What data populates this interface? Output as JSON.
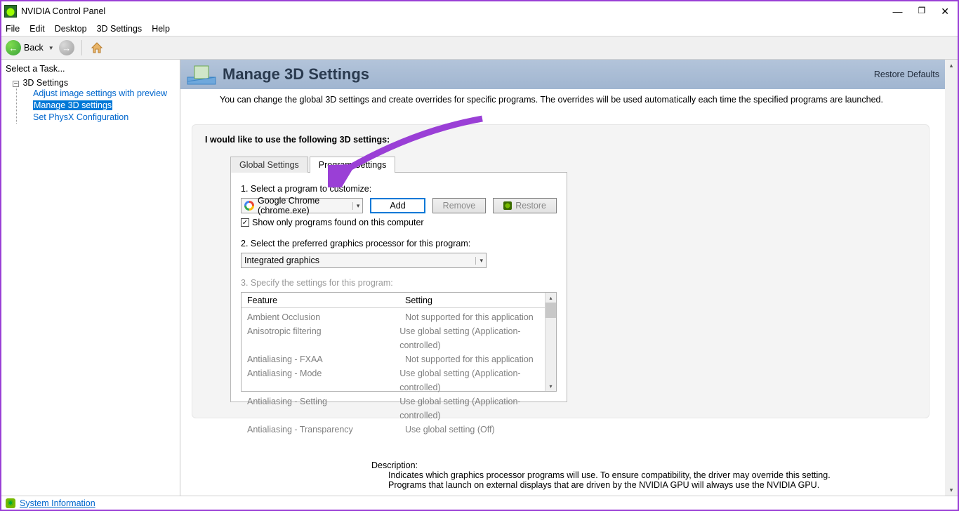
{
  "window": {
    "title": "NVIDIA Control Panel"
  },
  "menu": {
    "file": "File",
    "edit": "Edit",
    "desktop": "Desktop",
    "settings3d": "3D Settings",
    "help": "Help"
  },
  "toolbar": {
    "back": "Back"
  },
  "sidebar": {
    "header": "Select a Task...",
    "category": "3D Settings",
    "items": {
      "adjust": "Adjust image settings with preview",
      "manage": "Manage 3D settings",
      "physx": "Set PhysX Configuration"
    }
  },
  "page": {
    "title": "Manage 3D Settings",
    "restore": "Restore Defaults",
    "intro": "You can change the global 3D settings and create overrides for specific programs. The overrides will be used automatically each time the specified programs are launched.",
    "lead": "I would like to use the following 3D settings:"
  },
  "tabs": {
    "global": "Global Settings",
    "program": "Program Settings"
  },
  "step1": {
    "label": "1. Select a program to customize:",
    "selected": "Google Chrome (chrome.exe)",
    "add": "Add",
    "remove": "Remove",
    "restore": "Restore",
    "checkbox": "Show only programs found on this computer"
  },
  "step2": {
    "label": "2. Select the preferred graphics processor for this program:",
    "selected": "Integrated graphics"
  },
  "step3": {
    "label": "3. Specify the settings for this program:",
    "col_feature": "Feature",
    "col_setting": "Setting",
    "rows": [
      {
        "feature": "Ambient Occlusion",
        "setting": "Not supported for this application"
      },
      {
        "feature": "Anisotropic filtering",
        "setting": "Use global setting (Application-controlled)"
      },
      {
        "feature": "Antialiasing - FXAA",
        "setting": "Not supported for this application"
      },
      {
        "feature": "Antialiasing - Mode",
        "setting": "Use global setting (Application-controlled)"
      },
      {
        "feature": "Antialiasing - Setting",
        "setting": "Use global setting (Application-controlled)"
      },
      {
        "feature": "Antialiasing - Transparency",
        "setting": "Use global setting (Off)"
      }
    ]
  },
  "description": {
    "header": "Description:",
    "line1": "Indicates which graphics processor programs will use. To ensure compatibility, the driver may override this setting.",
    "line2": "Programs that launch on external displays that are driven by the NVIDIA GPU will always use the NVIDIA GPU."
  },
  "status": {
    "sysinfo": "System Information"
  }
}
